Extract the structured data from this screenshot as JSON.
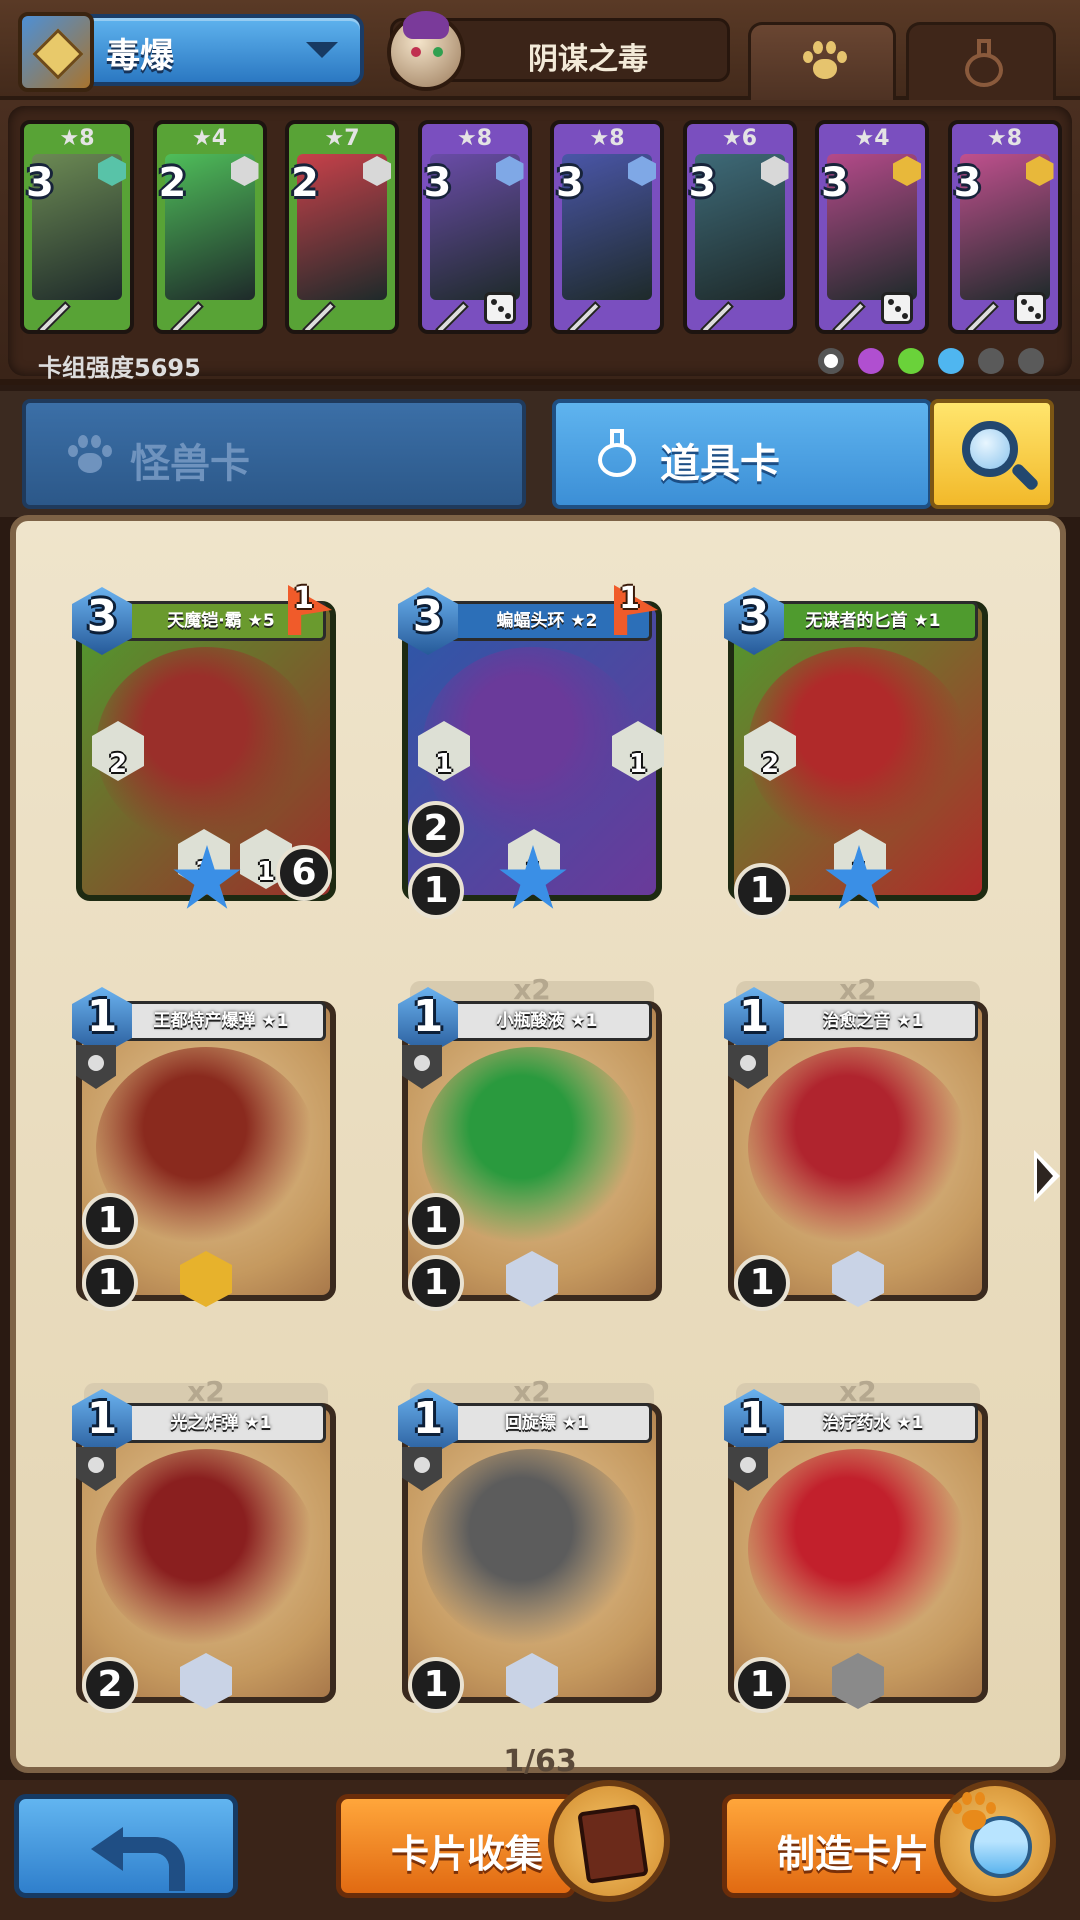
{
  "header": {
    "deck_name": "毒爆",
    "boss_name": "阴谋之毒",
    "tabs": [
      "monster-tab",
      "item-tab"
    ]
  },
  "deck": {
    "cards": [
      {
        "stars": "★8",
        "cost": "3",
        "color": "#58a336",
        "art": "#6c8a54",
        "gem": "#58c3a8",
        "dice": false
      },
      {
        "stars": "★4",
        "cost": "2",
        "color": "#58a336",
        "art": "#4fbe5a",
        "gem": "#d8d8d8",
        "dice": false
      },
      {
        "stars": "★7",
        "cost": "2",
        "color": "#58a336",
        "art": "#c8414a",
        "gem": "#d8d8d8",
        "dice": false
      },
      {
        "stars": "★8",
        "cost": "3",
        "color": "#7a4fbf",
        "art": "#6a4ca8",
        "gem": "#7fa8e6",
        "dice": true
      },
      {
        "stars": "★8",
        "cost": "3",
        "color": "#7a4fbf",
        "art": "#4a56a8",
        "gem": "#7fa8e6",
        "dice": false
      },
      {
        "stars": "★6",
        "cost": "3",
        "color": "#7a4fbf",
        "art": "#3e6a78",
        "gem": "#d8d8d8",
        "dice": false
      },
      {
        "stars": "★4",
        "cost": "3",
        "color": "#7a4fbf",
        "art": "#b54a8a",
        "gem": "#e8b83a",
        "dice": true
      },
      {
        "stars": "★8",
        "cost": "3",
        "color": "#7a4fbf",
        "art": "#c0508e",
        "gem": "#e8b83a",
        "dice": true
      }
    ],
    "strength_label": "卡组强度5695",
    "element_icons": [
      "neutral-icon",
      "shadow-icon",
      "nature-icon",
      "water-icon",
      "machine-icon",
      "fire-icon"
    ]
  },
  "category_tabs": {
    "monster_label": "怪兽卡",
    "item_label": "道具卡"
  },
  "cards": [
    {
      "name": "天魔铠·霸 ★5",
      "cost": "3",
      "flag": "1",
      "ribbon": "#6a9a2e",
      "frame": "#4f9b2e",
      "art": "#9a2f2a",
      "stats": [
        "2",
        "3",
        "1",
        "6"
      ],
      "dup": ""
    },
    {
      "name": "蝙蝠头环 ★2",
      "cost": "3",
      "flag": "1",
      "ribbon": "#2c6fb8",
      "frame": "#2c58a8",
      "art": "#6a3a9a",
      "stats": [
        "1",
        "1",
        "2",
        "1",
        "1"
      ],
      "dup": ""
    },
    {
      "name": "无谋者的匕首 ★1",
      "cost": "3",
      "flag": "",
      "ribbon": "#4f9b2e",
      "frame": "#4f9b2e",
      "art": "#b02a2a",
      "stats": [
        "2",
        "1",
        "1"
      ],
      "dup": ""
    },
    {
      "name": "王都特产爆弹 ★1",
      "cost": "1",
      "flag": "",
      "ribbon": "#e3e3e3",
      "frame": "#5a5a5a",
      "art": "#8a2a1e",
      "stats": [
        "1",
        "1"
      ],
      "dup": ""
    },
    {
      "name": "小瓶酸液 ★1",
      "cost": "1",
      "flag": "",
      "ribbon": "#e3e3e3",
      "frame": "#5a5a5a",
      "art": "#2a9a3e",
      "stats": [
        "1",
        "1"
      ],
      "dup": "x2"
    },
    {
      "name": "治愈之音 ★1",
      "cost": "1",
      "flag": "",
      "ribbon": "#e3e3e3",
      "frame": "#5a5a5a",
      "art": "#b0242e",
      "stats": [
        "1"
      ],
      "dup": "x2"
    },
    {
      "name": "光之炸弹 ★1",
      "cost": "1",
      "flag": "",
      "ribbon": "#e3e3e3",
      "frame": "#5a5a5a",
      "art": "#8a1f1f",
      "stats": [
        "2"
      ],
      "dup": "x2"
    },
    {
      "name": "回旋镖 ★1",
      "cost": "1",
      "flag": "",
      "ribbon": "#e3e3e3",
      "frame": "#5a5a5a",
      "art": "#5c5c5c",
      "stats": [
        "1"
      ],
      "dup": "x2"
    },
    {
      "name": "治疗药水 ★1",
      "cost": "1",
      "flag": "",
      "ribbon": "#e3e3e3",
      "frame": "#5a5a5a",
      "art": "#c2202c",
      "stats": [
        "1"
      ],
      "dup": "x2"
    }
  ],
  "pagination": {
    "text": "1/63"
  },
  "bottom": {
    "collect_label": "卡片收集",
    "craft_label": "制造卡片"
  }
}
